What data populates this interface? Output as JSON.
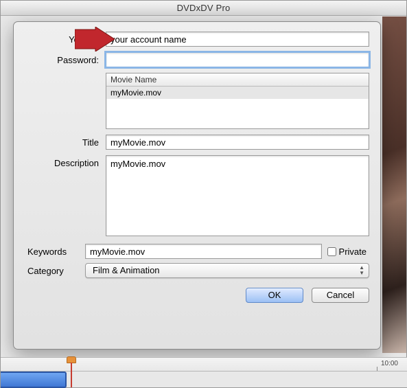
{
  "window": {
    "title": "DVDxDV Pro"
  },
  "form": {
    "youtube": {
      "label": "YouTub",
      "value": "your account name"
    },
    "password": {
      "label": "Password:",
      "value": ""
    },
    "movies": {
      "header": "Movie Name",
      "rows": [
        "myMovie.mov"
      ]
    },
    "title": {
      "label": "Title",
      "value": "myMovie.mov"
    },
    "description": {
      "label": "Description",
      "value": "myMovie.mov"
    },
    "keywords": {
      "label": "Keywords",
      "value": "myMovie.mov"
    },
    "private": {
      "label": "Private",
      "checked": false
    },
    "category": {
      "label": "Category",
      "value": "Film & Animation"
    }
  },
  "buttons": {
    "ok": "OK",
    "cancel": "Cancel"
  },
  "timeline": {
    "marker": "10:00"
  }
}
